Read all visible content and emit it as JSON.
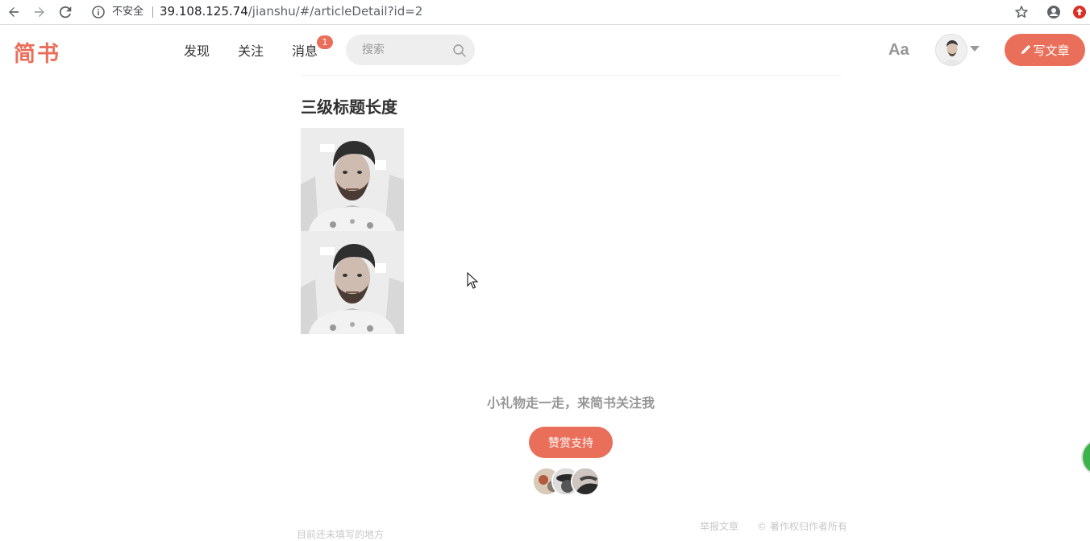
{
  "browser": {
    "security_label": "不安全",
    "url_host": "39.108.125.74",
    "url_path": "/jianshu/#/articleDetail?id=2"
  },
  "header": {
    "logo": "简书",
    "nav": [
      {
        "label": "发现"
      },
      {
        "label": "关注"
      },
      {
        "label": "消息",
        "badge": "1"
      }
    ],
    "search_placeholder": "搜索",
    "font_toggle": "Aa",
    "write_label": "写文章"
  },
  "article": {
    "heading": "三级标题长度"
  },
  "reward": {
    "title": "小礼物走一走，来简书关注我",
    "button": "赞赏支持"
  },
  "footer": {
    "left_text": "目前还未填写的地方",
    "report": "举报文章",
    "copyright": "© 著作权归作者所有"
  },
  "colors": {
    "brand": "#ea6f5a"
  }
}
